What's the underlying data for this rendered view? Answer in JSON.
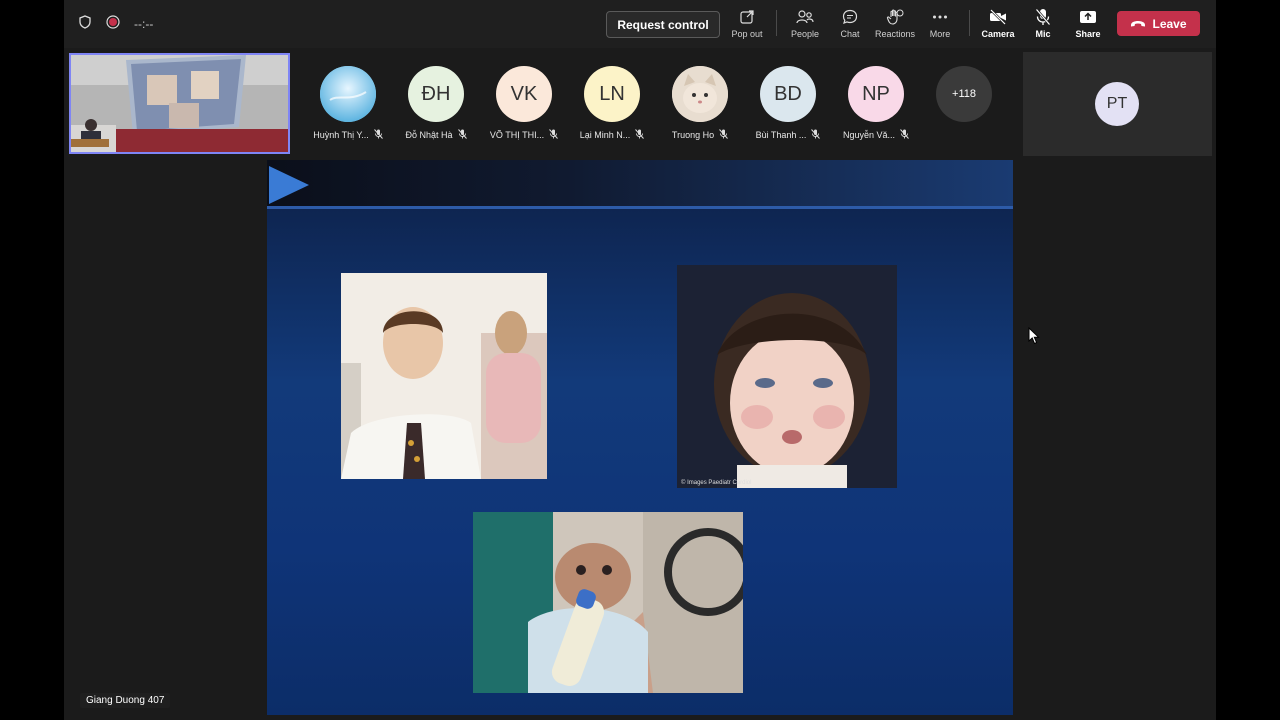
{
  "topbar": {
    "timer": "--:--",
    "request_control_label": "Request control",
    "items": {
      "pop_out": "Pop out",
      "people": "People",
      "chat": "Chat",
      "reactions": "Reactions",
      "more": "More",
      "camera": "Camera",
      "mic": "Mic",
      "share": "Share"
    },
    "leave_label": "Leave",
    "leave_color": "#c4314b"
  },
  "participants": [
    {
      "initials": "",
      "name": "Huỳnh Thị Y...",
      "bg": "#7ec8e8",
      "icon": "photo-avatar",
      "muted": true
    },
    {
      "initials": "ĐH",
      "name": "Đỗ Nhật Hà",
      "bg": "#e6f2e0",
      "muted": true
    },
    {
      "initials": "VK",
      "name": "VÕ THỊ THI...",
      "bg": "#fbe8da",
      "muted": true
    },
    {
      "initials": "LN",
      "name": "Lại Minh N...",
      "bg": "#fcf3c8",
      "muted": true
    },
    {
      "initials": "",
      "name": "Truong Ho",
      "bg": "#d9cfc2",
      "icon": "cat-photo-avatar",
      "muted": true
    },
    {
      "initials": "BD",
      "name": "Bùi Thanh ...",
      "bg": "#dbe7ee",
      "muted": true
    },
    {
      "initials": "NP",
      "name": "Nguyễn Vă...",
      "bg": "#f9d9e8",
      "muted": true
    }
  ],
  "overflow_count": "+118",
  "side_tile": {
    "initials": "PT"
  },
  "slide": {
    "photo_caption": "© Images Paediatr Cardiol"
  },
  "presenter_caption": "Giang Duong 407",
  "colors": {
    "accent": "#7f85f5",
    "slide_bg": "#123a7a"
  }
}
